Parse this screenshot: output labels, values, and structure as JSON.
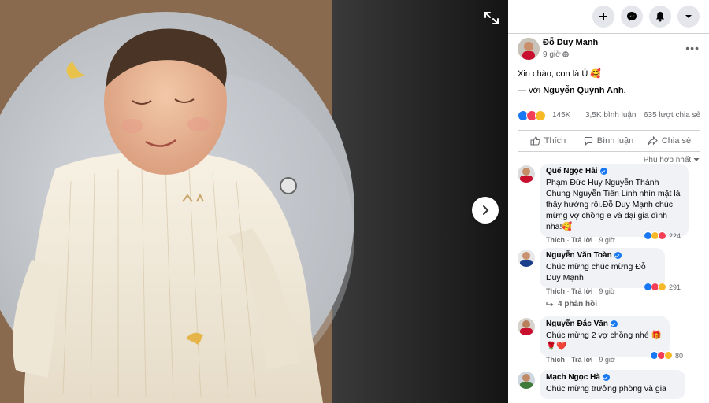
{
  "post": {
    "author": "Đỗ Duy Mạnh",
    "time": "9 giờ",
    "caption": "Xin chào, con là Ú 🥰",
    "tag_prefix": "— với ",
    "tag_name": "Nguyễn Quỳnh Anh",
    "tag_suffix": ".",
    "reactions": "145K",
    "comments": "3,5K bình luận",
    "shares": "635 lượt chia sẻ",
    "more_icon": "ellipsis-icon"
  },
  "actions": {
    "like": "Thích",
    "comment": "Bình luận",
    "share": "Chia sẻ"
  },
  "sort": "Phù hợp nhất",
  "comments": [
    {
      "name": "Quế Ngọc Hải",
      "text": "Phạm Đức Huy Nguyễn Thành Chung Nguyễn Tiến Linh nhìn mặt là thấy hưởng rồi.Đỗ Duy Mạnh chúc mừng vợ chồng e và đại gia đình nha!🥰",
      "like": "Thích",
      "reply": "Trả lời",
      "time": "9 giờ",
      "reactions": "224"
    },
    {
      "name": "Nguyễn Văn Toàn",
      "text": "Chúc mừng chúc mừng Đỗ Duy Mạnh",
      "like": "Thích",
      "reply": "Trả lời",
      "time": "9 giờ",
      "reactions": "291",
      "replies": "4 phản hồi"
    },
    {
      "name": "Nguyễn Đắc Văn",
      "text": "Chúc mừng 2 vợ chồng nhé 🎁🌹❤️",
      "like": "Thích",
      "reply": "Trả lời",
      "time": "9 giờ",
      "reactions": "80"
    },
    {
      "name": "Mạch Ngọc Hà",
      "text": "Chúc mừng trưởng phòng và gia"
    }
  ],
  "colors": {
    "accent": "#1877f2",
    "like_blue": "#1877f2",
    "love_red": "#f33e58",
    "haha_yellow": "#f7b928"
  }
}
